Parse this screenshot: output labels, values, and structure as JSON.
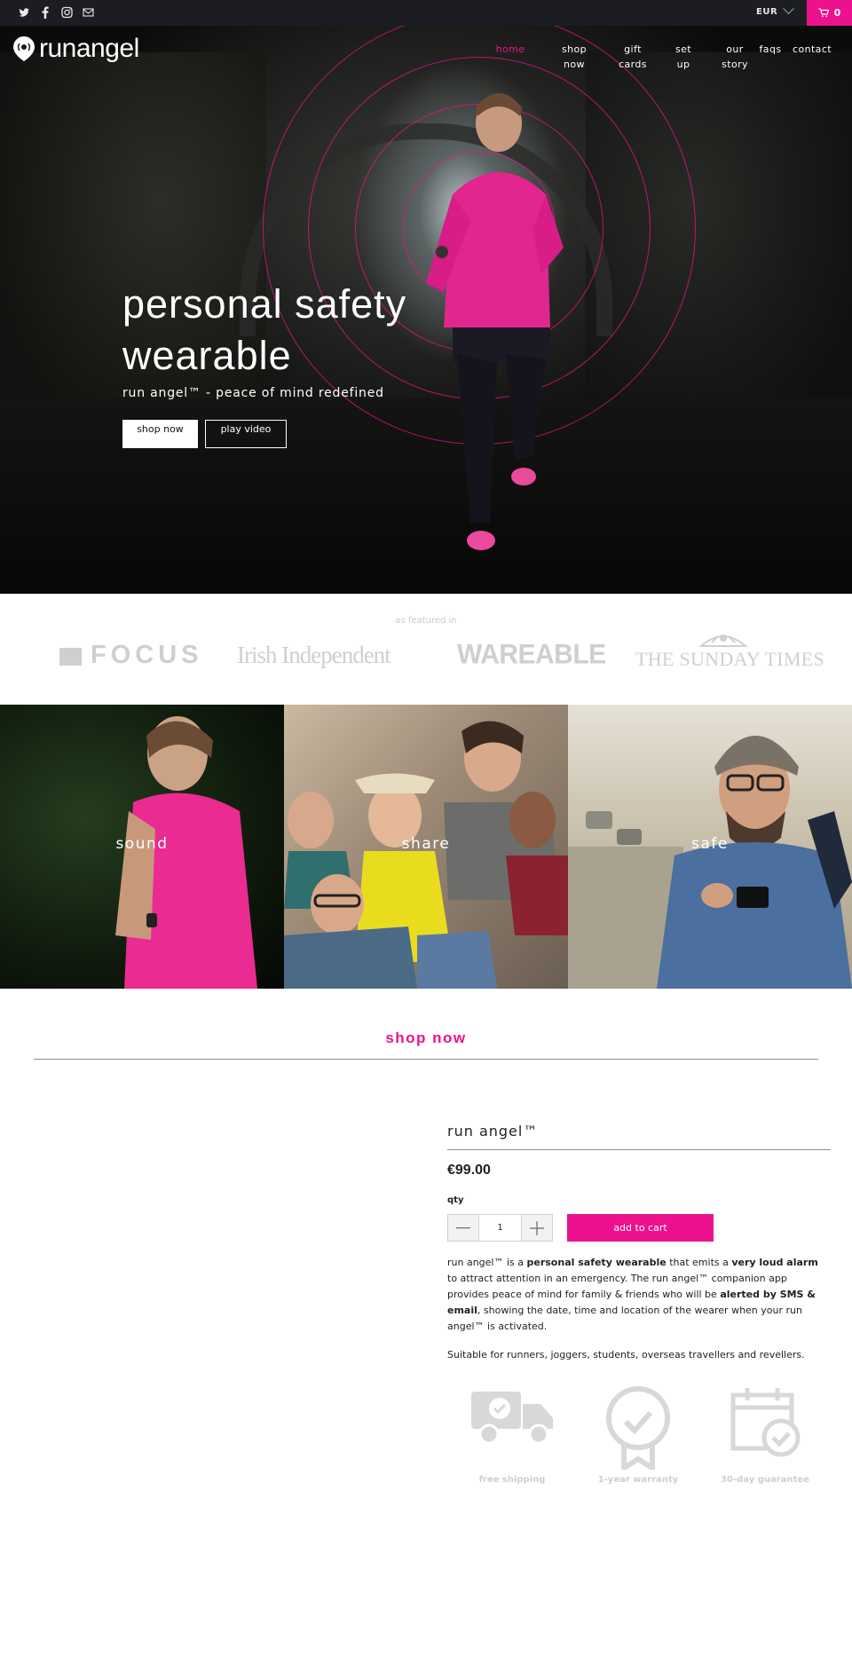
{
  "topbar": {
    "social": [
      {
        "name": "twitter",
        "glyph": "🐦"
      },
      {
        "name": "facebook",
        "glyph": "f"
      },
      {
        "name": "instagram",
        "glyph": "◎"
      },
      {
        "name": "email",
        "glyph": "✉"
      }
    ],
    "currency": "EUR",
    "cart_count": "0"
  },
  "brand": {
    "name": "runangel"
  },
  "nav": [
    {
      "label": "home",
      "active": true
    },
    {
      "label": "shop now",
      "active": false
    },
    {
      "label": "gift cards",
      "active": false
    },
    {
      "label": "set up",
      "active": false
    },
    {
      "label": "our story",
      "active": false
    },
    {
      "label": "faqs",
      "active": false
    },
    {
      "label": "contact",
      "active": false
    }
  ],
  "hero": {
    "title": "personal safety wearable",
    "subtitle": "run angel™ - peace of mind redefined",
    "primary_button": "shop now",
    "secondary_button": "play video"
  },
  "featured": {
    "label": "as featured in",
    "press": [
      "FOCUS",
      "Irish Independent",
      "WAREABLE",
      "THE SUNDAY TIMES"
    ]
  },
  "tiles": [
    {
      "label": "sound"
    },
    {
      "label": "share"
    },
    {
      "label": "safe"
    }
  ],
  "shop": {
    "heading": "shop now",
    "product_title": "run angel™",
    "price": "€99.00",
    "qty_label": "qty",
    "qty_value": "1",
    "add_to_cart": "add to cart",
    "description": {
      "p1_a": "run angel™ is a ",
      "p1_b": "personal safety wearable",
      "p1_c": " that emits a ",
      "p1_d": "very loud alarm",
      "p1_e": " to attract attention in an emergency. The run angel™ companion app provides peace of mind for family & friends who will be ",
      "p1_f": "alerted by SMS & email",
      "p1_g": ", showing the date, time and location of the wearer when your run angel™ is activated.",
      "p2": "Suitable for runners, joggers, students, overseas travellers and revellers."
    },
    "features": [
      {
        "label": "free shipping",
        "icon": "truck-icon"
      },
      {
        "label": "1-year warranty",
        "icon": "ribbon-icon"
      },
      {
        "label": "30-day guarantee",
        "icon": "calendar-icon"
      }
    ]
  },
  "colors": {
    "accent": "#ec128d",
    "topbar": "#1c1d22",
    "muted": "#cfcfcf"
  }
}
